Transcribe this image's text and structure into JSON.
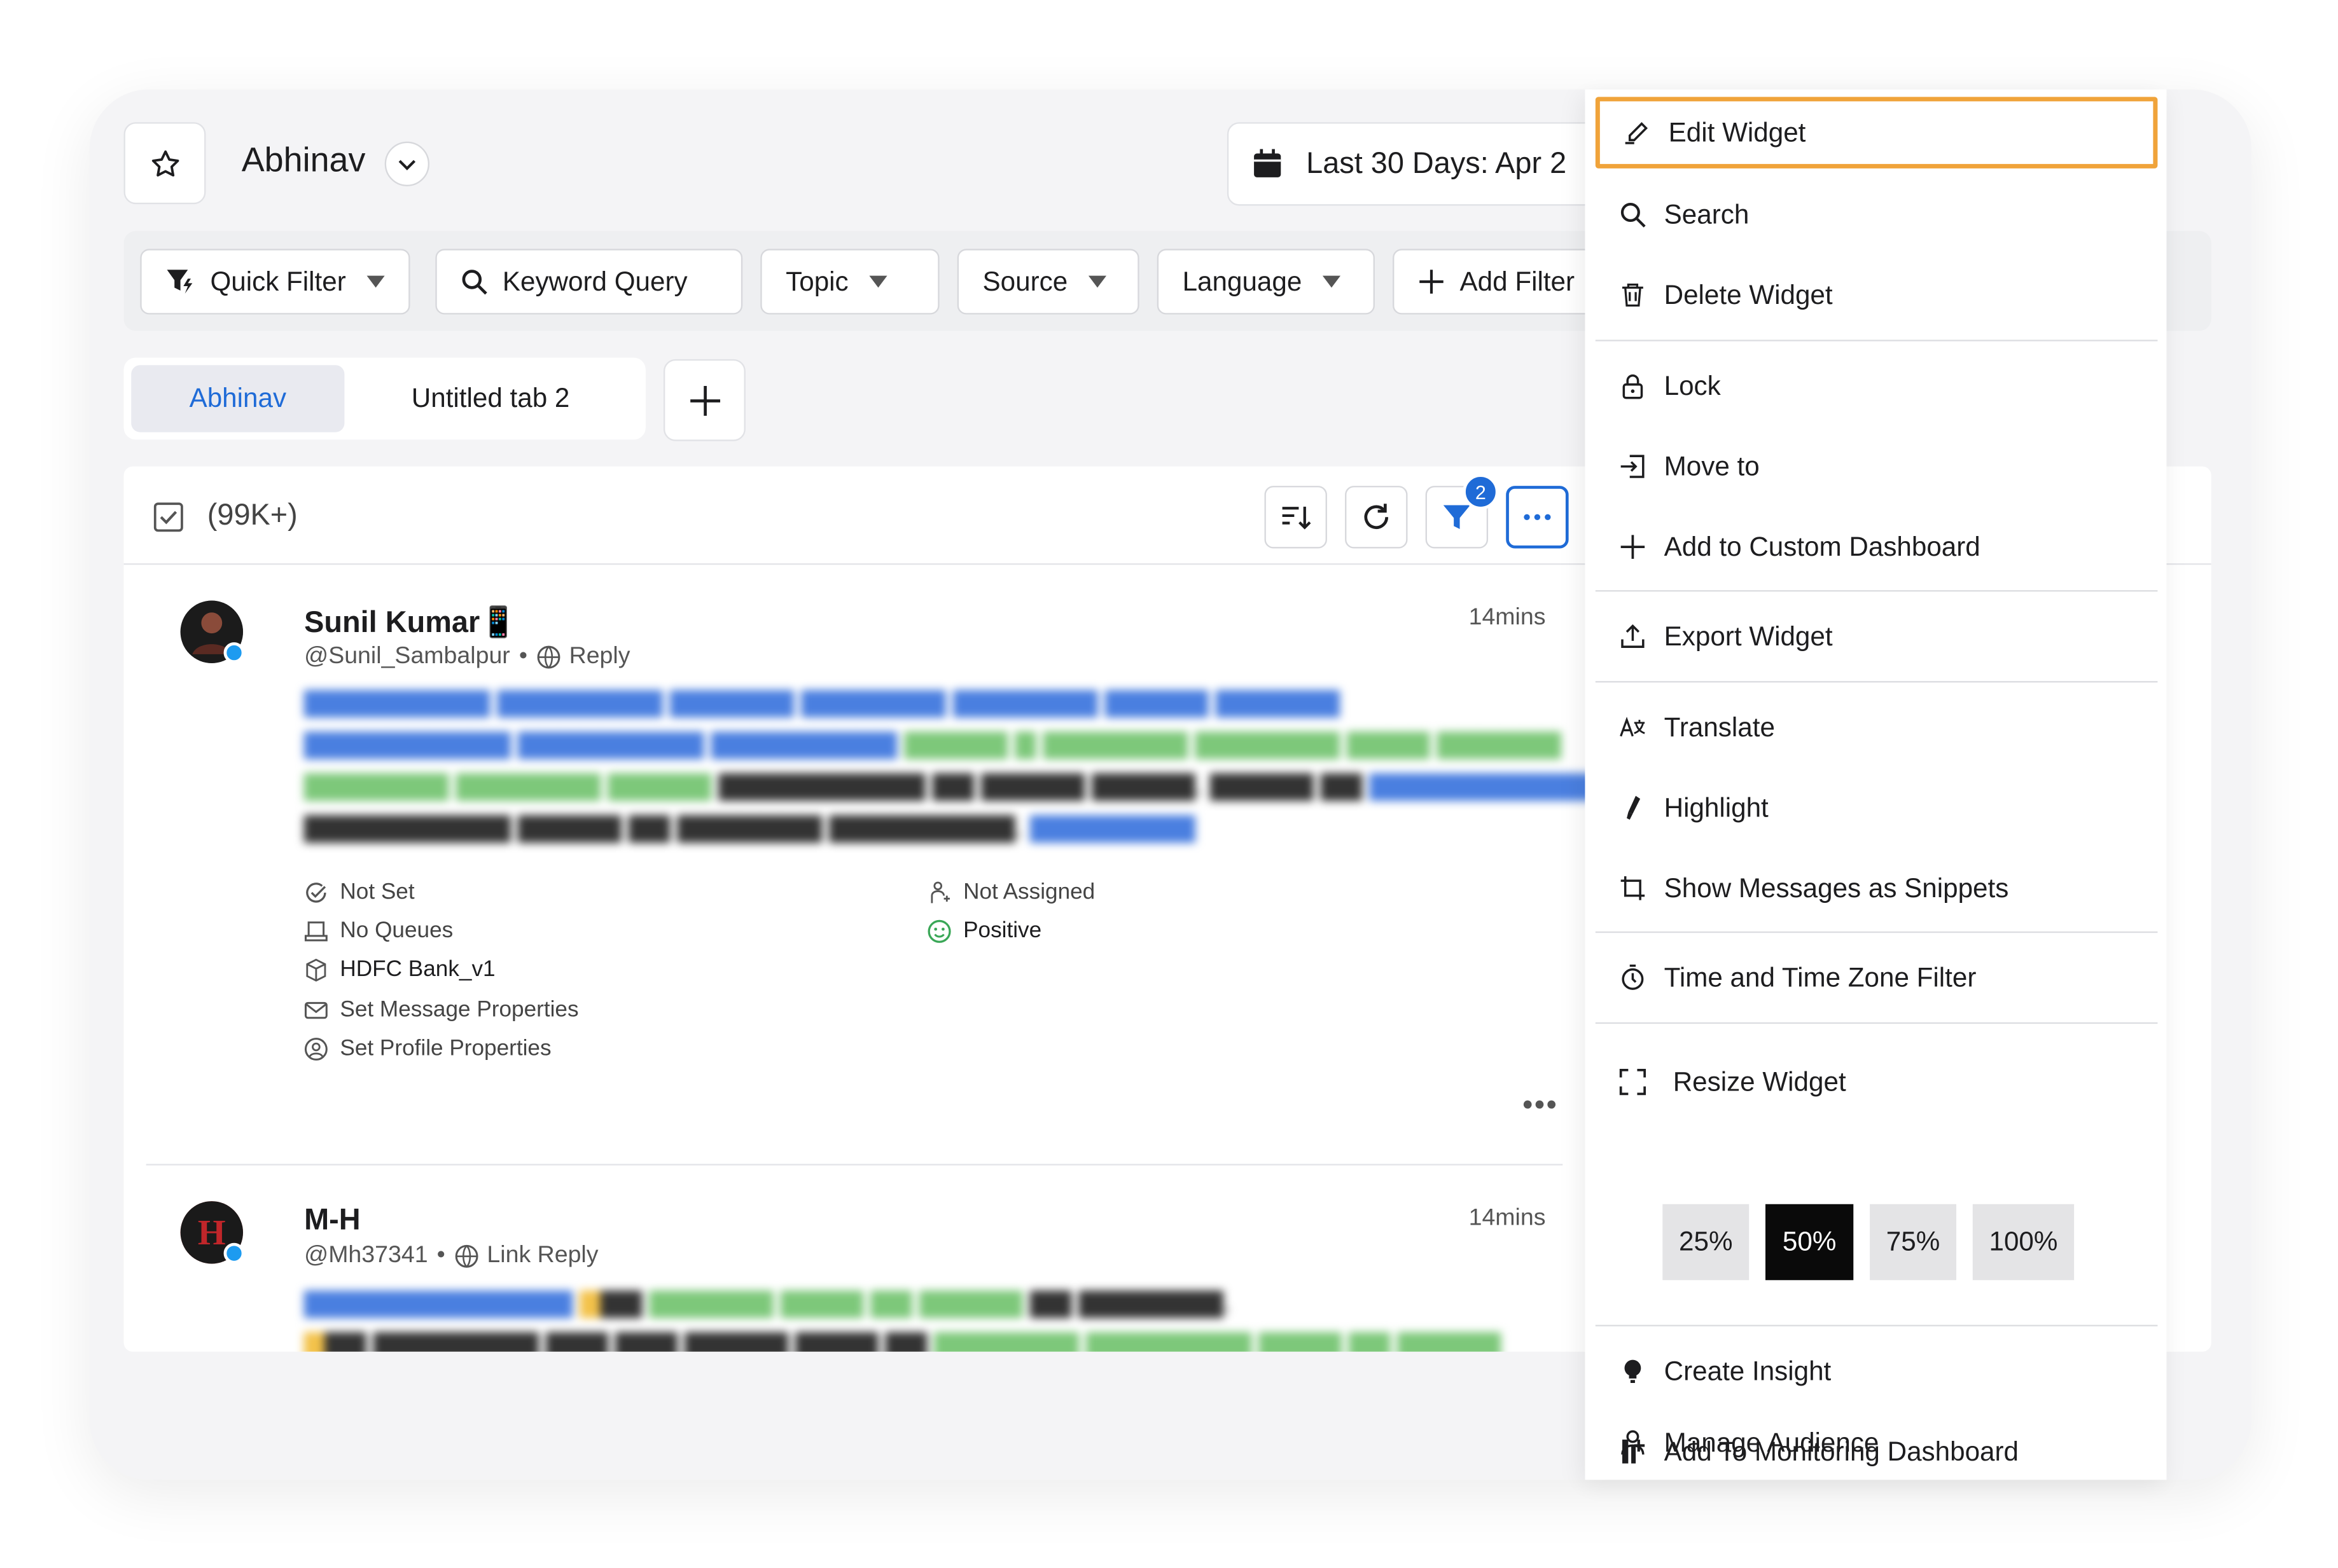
{
  "header": {
    "dashboard_title": "Abhinav",
    "date_range": "Last 30 Days: Apr 2"
  },
  "filters": [
    {
      "label": "Quick Filter"
    },
    {
      "label": "Keyword Query"
    },
    {
      "label": "Topic"
    },
    {
      "label": "Source"
    },
    {
      "label": "Language"
    },
    {
      "label": "Add Filter"
    }
  ],
  "tabs": {
    "items": [
      {
        "label": "Abhinav",
        "active": true
      },
      {
        "label": "Untitled tab 2",
        "active": false
      }
    ]
  },
  "widget": {
    "count": "(99K+)",
    "filter_badge": "2",
    "posts": [
      {
        "author": "Sunil Kumar📱",
        "handle": "@Sunil_Sambalpur",
        "separator": "•",
        "action": "Reply",
        "time": "14mins",
        "properties_left": [
          "Not Set",
          "No Queues",
          "HDFC Bank_v1",
          "Set Message Properties",
          "Set Profile Properties"
        ],
        "properties_right": [
          "Not Assigned",
          "Positive"
        ]
      },
      {
        "author": "M-H",
        "handle": "@Mh37341",
        "separator": "•",
        "action": "Link Reply",
        "time": "14mins"
      }
    ]
  },
  "menu": {
    "items": [
      {
        "label": "Edit Widget",
        "icon": "pencil-icon"
      },
      {
        "label": "Search",
        "icon": "search-icon"
      },
      {
        "label": "Delete Widget",
        "icon": "trash-icon"
      },
      {
        "label": "Lock",
        "icon": "lock-icon"
      },
      {
        "label": "Move to",
        "icon": "move-to-icon"
      },
      {
        "label": "Add to Custom Dashboard",
        "icon": "plus-icon"
      },
      {
        "label": "Export Widget",
        "icon": "export-icon"
      },
      {
        "label": "Translate",
        "icon": "translate-icon"
      },
      {
        "label": "Highlight",
        "icon": "highlighter-icon"
      },
      {
        "label": "Show Messages as Snippets",
        "icon": "crop-icon"
      },
      {
        "label": "Time and Time Zone Filter",
        "icon": "stopwatch-icon"
      },
      {
        "label": "Resize Widget",
        "icon": "resize-icon"
      },
      {
        "label": "Create Insight",
        "icon": "lightbulb-icon"
      },
      {
        "label": "Add To Monitoring Dashboard",
        "icon": "monitoring-icon"
      },
      {
        "label": "Manage Audience",
        "icon": "person-icon"
      }
    ],
    "resize_options": [
      "25%",
      "50%",
      "75%",
      "100%"
    ],
    "resize_selected": "50%"
  },
  "colors": {
    "accent": "#1f6bd7",
    "selected_outline": "#f0a33a",
    "positive": "#3aa757"
  }
}
